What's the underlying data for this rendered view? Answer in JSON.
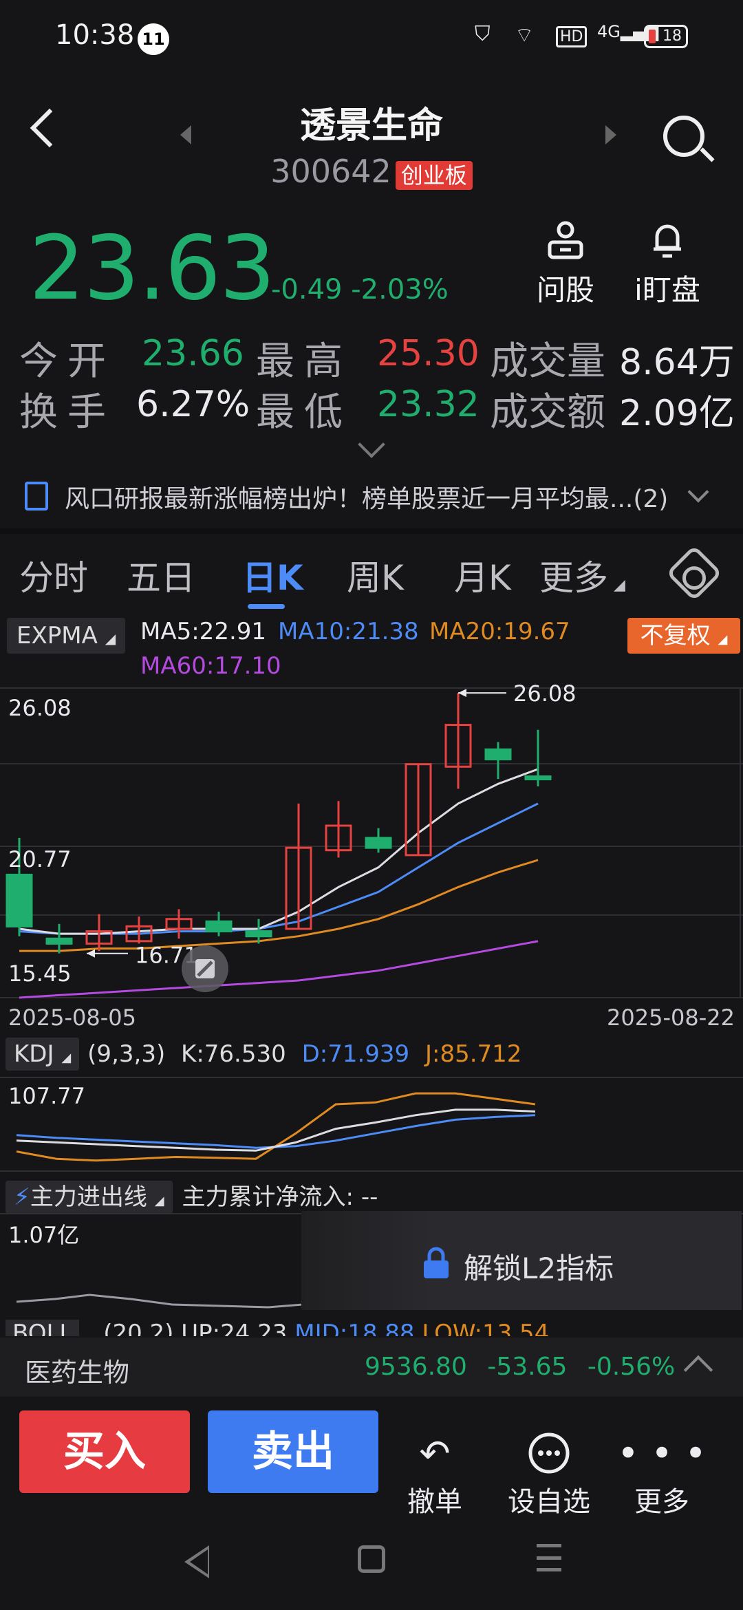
{
  "status_bar": {
    "time": "10:38",
    "notification_count": "11",
    "battery": "18"
  },
  "header": {
    "name": "透景生命",
    "code": "300642",
    "board": "创业板"
  },
  "quote": {
    "price": "23.63",
    "change": "-0.49",
    "change_pct": "-2.03%"
  },
  "actions": {
    "ask_label": "问股",
    "watch_label": "i盯盘"
  },
  "stats": {
    "open_label": "今开",
    "open": "23.66",
    "high_label": "最高",
    "high": "25.30",
    "volume_label": "成交量",
    "volume": "8.64万",
    "turnover_label": "换手",
    "turnover": "6.27%",
    "low_label": "最低",
    "low": "23.32",
    "amount_label": "成交额",
    "amount": "2.09亿"
  },
  "news": {
    "text": "风口研报最新涨幅榜出炉！榜单股票近一月平均最...(2)"
  },
  "tabs": [
    "分时",
    "五日",
    "日K",
    "周K",
    "月K",
    "更多"
  ],
  "chart_header": {
    "indicator": "EXPMA",
    "ma5": "MA5:22.91",
    "ma10": "MA10:21.38",
    "ma20": "MA20:19.67",
    "ma60": "MA60:17.10",
    "adjust": "不复权"
  },
  "chart_data": {
    "type": "candlestick",
    "y_labels": [
      "26.08",
      "20.77",
      "15.45"
    ],
    "high_marker": "26.08",
    "low_marker": "16.71",
    "date_start": "2025-08-05",
    "date_end": "2025-08-22",
    "candles": [
      {
        "o": 20.0,
        "c": 17.9,
        "h": 21.5,
        "l": 17.5
      },
      {
        "o": 17.4,
        "c": 17.2,
        "h": 18.0,
        "l": 16.8
      },
      {
        "o": 17.2,
        "c": 17.7,
        "h": 18.4,
        "l": 16.9
      },
      {
        "o": 17.3,
        "c": 17.9,
        "h": 18.3,
        "l": 17.2
      },
      {
        "o": 17.8,
        "c": 18.2,
        "h": 18.6,
        "l": 17.4
      },
      {
        "o": 18.1,
        "c": 17.7,
        "h": 18.5,
        "l": 17.5
      },
      {
        "o": 17.7,
        "c": 17.5,
        "h": 18.2,
        "l": 17.2
      },
      {
        "o": 17.8,
        "c": 21.1,
        "h": 22.9,
        "l": 17.8
      },
      {
        "o": 21.0,
        "c": 22.0,
        "h": 23.0,
        "l": 20.7
      },
      {
        "o": 21.5,
        "c": 21.1,
        "h": 21.9,
        "l": 20.9
      },
      {
        "o": 20.8,
        "c": 24.5,
        "h": 24.5,
        "l": 20.8
      },
      {
        "o": 24.4,
        "c": 26.1,
        "h": 27.4,
        "l": 23.5
      },
      {
        "o": 25.1,
        "c": 24.7,
        "h": 25.4,
        "l": 23.9
      },
      {
        "o": 24.0,
        "c": 23.9,
        "h": 25.9,
        "l": 23.6
      }
    ],
    "ma5": [
      17.8,
      17.6,
      17.6,
      17.7,
      17.8,
      17.8,
      17.8,
      18.5,
      19.5,
      20.3,
      21.7,
      22.9,
      23.7,
      24.3
    ],
    "ma10": [
      17.7,
      17.6,
      17.6,
      17.6,
      17.7,
      17.7,
      17.8,
      18.1,
      18.7,
      19.3,
      20.3,
      21.3,
      22.1,
      22.9
    ],
    "ma20": [
      16.9,
      16.9,
      17.0,
      17.0,
      17.1,
      17.2,
      17.3,
      17.5,
      17.8,
      18.2,
      18.8,
      19.5,
      20.1,
      20.6
    ],
    "ma60": [
      15.0,
      15.1,
      15.2,
      15.3,
      15.4,
      15.5,
      15.6,
      15.7,
      15.9,
      16.1,
      16.4,
      16.7,
      17.0,
      17.3
    ],
    "ylim": [
      15.0,
      27.6
    ]
  },
  "kdj": {
    "label": "KDJ",
    "params": "(9,3,3)",
    "k": "K:76.530",
    "d": "D:71.939",
    "j": "J:85.712",
    "y_label": "107.77",
    "k_vals": [
      32,
      30,
      28,
      26,
      24,
      22,
      21,
      30,
      45,
      52,
      60,
      66,
      66,
      64
    ],
    "d_vals": [
      38,
      35,
      33,
      31,
      29,
      27,
      24,
      26,
      32,
      40,
      48,
      55,
      58,
      60
    ],
    "j_vals": [
      20,
      12,
      10,
      12,
      14,
      13,
      12,
      40,
      72,
      74,
      84,
      84,
      78,
      72
    ]
  },
  "flow": {
    "label": "主力进出线",
    "net_label": "主力累计净流入:",
    "net_value": "--",
    "y_label": "1.07亿",
    "unlock": "解锁L2指标"
  },
  "boll": {
    "text": "BOLL",
    "params": "(20,2)",
    "up": "UP:24.23",
    "mid": "MID:18.88",
    "low": "LOW:13.54"
  },
  "sector": {
    "name": "医药生物",
    "value": "9536.80",
    "change": "-53.65",
    "pct": "-0.56%"
  },
  "trade": {
    "buy": "买入",
    "sell": "卖出",
    "cancel": "撤单",
    "watchlist": "设自选",
    "more": "更多"
  }
}
